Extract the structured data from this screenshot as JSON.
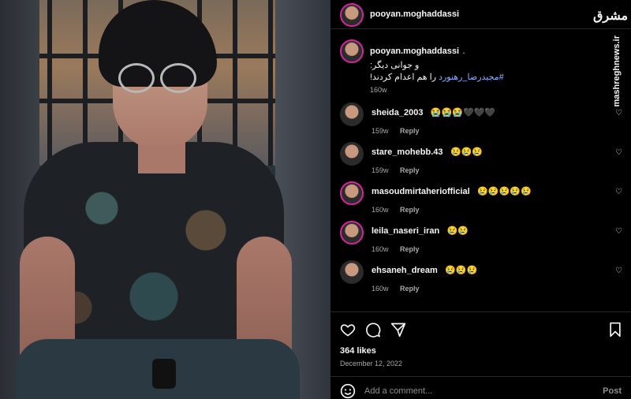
{
  "post": {
    "username": "pooyan.moghaddassi",
    "caption": {
      "username": "pooyan.moghaddassi",
      "line1": "و جوانی دیگر:",
      "line2_text": "را هم اعدام کردند!",
      "hashtag": "#مجیدرضا_رهنورد",
      "time": "160w"
    },
    "likes": "364 likes",
    "date": "December 12, 2022"
  },
  "comments": [
    {
      "username": "sheida_2003",
      "text": "😭😭😭🖤🖤🖤",
      "time": "159w",
      "reply": "Reply"
    },
    {
      "username": "stare_mohebb.43",
      "text": "😢😢😢",
      "time": "159w",
      "reply": "Reply"
    },
    {
      "username": "masoudmirtaheriofficial",
      "text": "😢😢😢😢😢",
      "time": "160w",
      "reply": "Reply"
    },
    {
      "username": "leila_naseri_iran",
      "text": "😢😢",
      "time": "160w",
      "reply": "Reply"
    },
    {
      "username": "ehsaneh_dream",
      "text": "😢😢😢",
      "time": "160w",
      "reply": "Reply"
    }
  ],
  "add_comment": {
    "placeholder": "Add a comment...",
    "post_label": "Post"
  },
  "watermark": {
    "brand": "مشرق",
    "url": "mashreghnews.ir"
  },
  "icons": {
    "like": "heart-icon",
    "comment": "comment-icon",
    "share": "send-icon",
    "save": "bookmark-icon",
    "emoji": "emoji-icon"
  }
}
